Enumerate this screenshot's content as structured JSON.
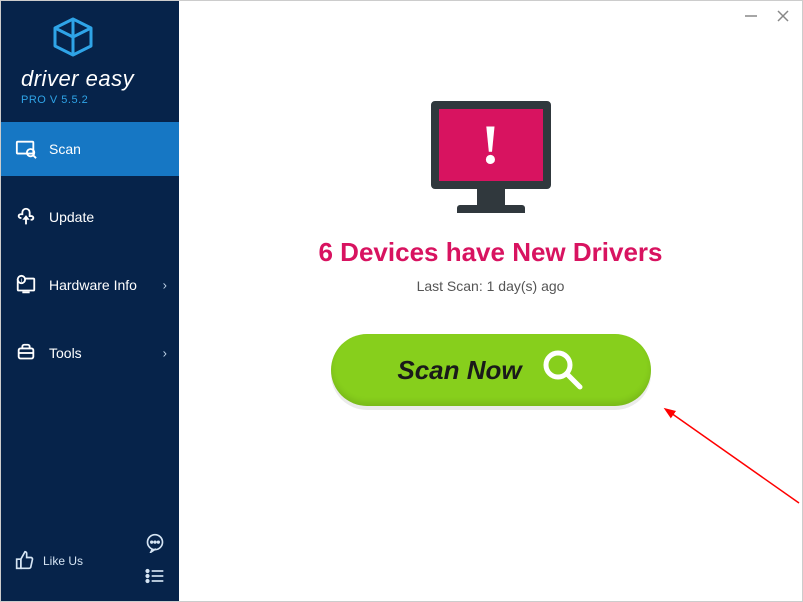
{
  "brand": {
    "name": "driver easy",
    "version": "PRO V 5.5.2"
  },
  "nav": {
    "scan": "Scan",
    "update": "Update",
    "hardware": "Hardware Info",
    "tools": "Tools",
    "likeus": "Like Us"
  },
  "main": {
    "monitor_mark": "!",
    "headline": "6 Devices have New Drivers",
    "lastscan": "Last Scan: 1 day(s) ago",
    "scan_button": "Scan Now"
  }
}
